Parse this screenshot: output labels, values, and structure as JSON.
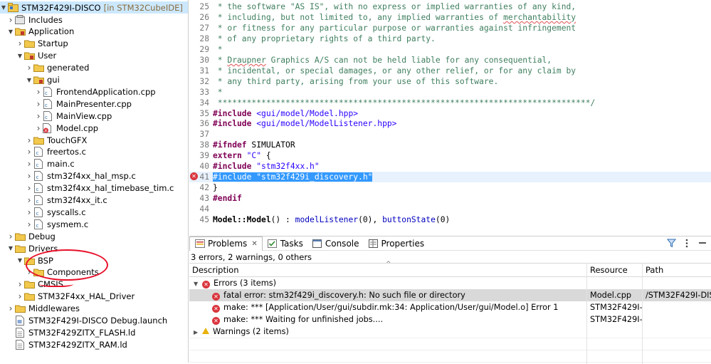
{
  "explorer": {
    "project_name": "STM32F429I-DISCO",
    "project_suffix": "[in STM32CubeIDE]",
    "items": [
      {
        "label": "Includes",
        "depth": 1,
        "twisty": "collapsed",
        "icon": "includes-icon"
      },
      {
        "label": "Application",
        "depth": 1,
        "twisty": "expanded",
        "icon": "source-folder-icon"
      },
      {
        "label": "Startup",
        "depth": 2,
        "twisty": "collapsed",
        "icon": "folder-icon"
      },
      {
        "label": "User",
        "depth": 2,
        "twisty": "expanded",
        "icon": "source-folder-icon"
      },
      {
        "label": "generated",
        "depth": 3,
        "twisty": "collapsed",
        "icon": "folder-icon"
      },
      {
        "label": "gui",
        "depth": 3,
        "twisty": "expanded",
        "icon": "source-folder-icon"
      },
      {
        "label": "FrontendApplication.cpp",
        "depth": 4,
        "twisty": "collapsed",
        "icon": "cpp-file-icon"
      },
      {
        "label": "MainPresenter.cpp",
        "depth": 4,
        "twisty": "collapsed",
        "icon": "cpp-file-icon"
      },
      {
        "label": "MainView.cpp",
        "depth": 4,
        "twisty": "collapsed",
        "icon": "cpp-file-icon"
      },
      {
        "label": "Model.cpp",
        "depth": 4,
        "twisty": "collapsed",
        "icon": "cpp-file-error-icon"
      },
      {
        "label": "TouchGFX",
        "depth": 3,
        "twisty": "collapsed",
        "icon": "folder-icon"
      },
      {
        "label": "freertos.c",
        "depth": 3,
        "twisty": "collapsed",
        "icon": "c-file-icon"
      },
      {
        "label": "main.c",
        "depth": 3,
        "twisty": "collapsed",
        "icon": "c-file-icon"
      },
      {
        "label": "stm32f4xx_hal_msp.c",
        "depth": 3,
        "twisty": "collapsed",
        "icon": "c-file-icon"
      },
      {
        "label": "stm32f4xx_hal_timebase_tim.c",
        "depth": 3,
        "twisty": "collapsed",
        "icon": "c-file-icon"
      },
      {
        "label": "stm32f4xx_it.c",
        "depth": 3,
        "twisty": "collapsed",
        "icon": "c-file-icon"
      },
      {
        "label": "syscalls.c",
        "depth": 3,
        "twisty": "collapsed",
        "icon": "c-file-icon"
      },
      {
        "label": "sysmem.c",
        "depth": 3,
        "twisty": "collapsed",
        "icon": "c-file-icon"
      },
      {
        "label": "Debug",
        "depth": 1,
        "twisty": "collapsed",
        "icon": "folder-icon"
      },
      {
        "label": "Drivers",
        "depth": 1,
        "twisty": "expanded",
        "icon": "folder-icon"
      },
      {
        "label": "BSP",
        "depth": 2,
        "twisty": "expanded",
        "icon": "folder-icon"
      },
      {
        "label": "Components",
        "depth": 3,
        "twisty": "collapsed",
        "icon": "folder-icon"
      },
      {
        "label": "CMSIS",
        "depth": 2,
        "twisty": "collapsed",
        "icon": "folder-icon"
      },
      {
        "label": "STM32F4xx_HAL_Driver",
        "depth": 2,
        "twisty": "collapsed",
        "icon": "folder-icon"
      },
      {
        "label": "Middlewares",
        "depth": 1,
        "twisty": "collapsed",
        "icon": "folder-icon"
      },
      {
        "label": "STM32F429I-DISCO Debug.launch",
        "depth": 1,
        "twisty": "none",
        "icon": "launch-file-icon"
      },
      {
        "label": "STM32F429ZITX_FLASH.ld",
        "depth": 1,
        "twisty": "none",
        "icon": "ld-file-icon"
      },
      {
        "label": "STM32F429ZITX_RAM.ld",
        "depth": 1,
        "twisty": "none",
        "icon": "ld-file-icon"
      }
    ]
  },
  "editor": {
    "lines": [
      {
        "num": "25",
        "code": " * the software \"AS IS\", with no express or implied warranties of any kind,"
      },
      {
        "num": "26",
        "code_a": " * including, but not limited to, any implied warranties of ",
        "code_b": "merchantability"
      },
      {
        "num": "27",
        "code": " * or fitness for any particular purpose or warranties against infringement"
      },
      {
        "num": "28",
        "code": " * of any proprietary rights of a third party."
      },
      {
        "num": "29",
        "code": " *"
      },
      {
        "num": "30",
        "code_a": " * ",
        "code_b": "Draupner",
        "code_c": " Graphics A/S can not be held liable for any consequential,"
      },
      {
        "num": "31",
        "code": " * incidental, or special damages, or any other relief, or for any claim by"
      },
      {
        "num": "32",
        "code": " * any third party, arising from your use of this software."
      },
      {
        "num": "33",
        "code": " *"
      },
      {
        "num": "34",
        "code": " *****************************************************************************/"
      },
      {
        "num": "35",
        "kw": "#include",
        "str": "<gui/model/Model.hpp>"
      },
      {
        "num": "36",
        "kw": "#include",
        "str": "<gui/model/ModelListener.hpp>"
      },
      {
        "num": "37"
      },
      {
        "num": "38",
        "kw": "#ifndef",
        "plain": " SIMULATOR"
      },
      {
        "num": "39",
        "kw": "extern",
        "str": "\"C\"",
        "plain": " {"
      },
      {
        "num": "40",
        "kw": "#include",
        "str": "\"stm32f4xx.h\""
      },
      {
        "num": "41",
        "sel": "#include \"stm32f429i_discovery.h\""
      },
      {
        "num": "42",
        "plain": "}"
      },
      {
        "num": "43",
        "kw": "#endif"
      },
      {
        "num": "44"
      },
      {
        "num": "45",
        "fn": "Model::Model",
        "plain_a": "() : ",
        "var_a": "modelListener",
        "plain_b": "(0), ",
        "var_b": "buttonState",
        "plain_c": "(0)"
      }
    ]
  },
  "problems": {
    "tabs": [
      {
        "label": "Problems",
        "icon": "problems-icon",
        "active": true
      },
      {
        "label": "Tasks",
        "icon": "tasks-icon",
        "active": false
      },
      {
        "label": "Console",
        "icon": "console-icon",
        "active": false
      },
      {
        "label": "Properties",
        "icon": "properties-icon",
        "active": false
      }
    ],
    "close_glyph": "✕",
    "summary": "3 errors, 2 warnings, 0 others",
    "columns": {
      "description": "Description",
      "resource": "Resource",
      "path": "Path"
    },
    "errors_group": "Errors (3 items)",
    "warnings_group": "Warnings (2 items)",
    "rows": [
      {
        "description": "fatal error: stm32f429i_discovery.h: No such file or directory",
        "resource": "Model.cpp",
        "path": "/STM32F429I-DIS"
      },
      {
        "description": "make: *** [Application/User/gui/subdir.mk:34: Application/User/gui/Model.o] Error 1",
        "resource": "STM32F429I-...",
        "path": ""
      },
      {
        "description": "make: *** Waiting for unfinished jobs....",
        "resource": "STM32F429I-...",
        "path": ""
      }
    ]
  },
  "colors": {
    "comment": "#3f7f5f",
    "keyword": "#7f0055",
    "string": "#2a00ff",
    "selection": "#3399ff",
    "error": "#d9363e",
    "warning": "#e8b10c",
    "annotation": "#e8102a"
  }
}
